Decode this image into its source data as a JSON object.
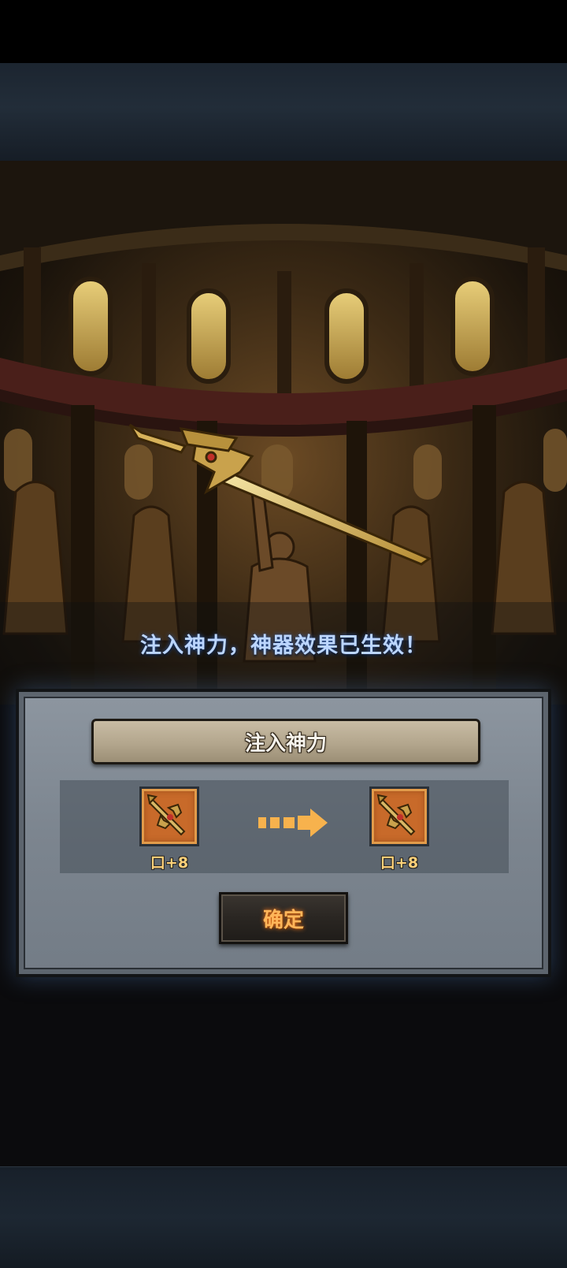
{
  "scene": {
    "message": "注入神力，神器效果已生效！"
  },
  "dialog": {
    "title": "注入神力",
    "before_item": {
      "icon": "sword-icon",
      "label": "口+8"
    },
    "after_item": {
      "icon": "sword-icon",
      "label": "口+8"
    },
    "arrow_icon": "arrow-right-icon",
    "confirm_label": "确定"
  },
  "colors": {
    "message_text": "#bcd6ff",
    "item_label": "#ffd27a",
    "confirm_text": "#ffb65a",
    "item_frame": "#c86a2a"
  }
}
